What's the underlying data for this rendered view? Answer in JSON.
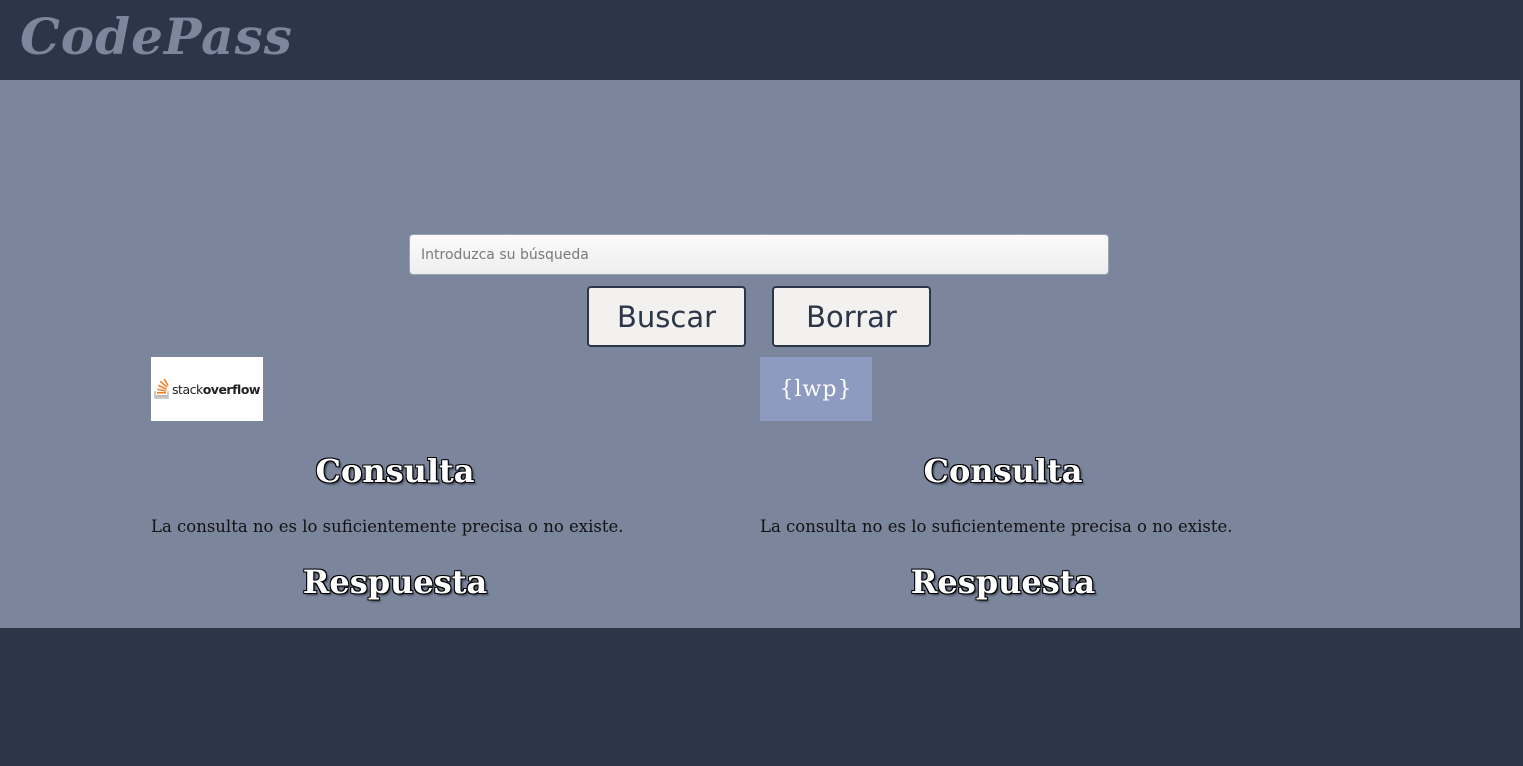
{
  "header": {
    "brand": "CodePass"
  },
  "search": {
    "placeholder": "Introduzca su búsqueda",
    "value": "",
    "search_button": "Buscar",
    "clear_button": "Borrar"
  },
  "results": [
    {
      "source": "stackoverflow",
      "logo_text_regular": "stack",
      "logo_text_bold": "overflow",
      "query_heading": "Consulta",
      "message": "La consulta no es lo suficientemente precisa o no existe.",
      "answer_heading": "Respuesta"
    },
    {
      "source": "lwp",
      "logo_text": "{lwp}",
      "query_heading": "Consulta",
      "message": "La consulta no es lo suficientemente precisa o no existe.",
      "answer_heading": "Respuesta"
    }
  ],
  "colors": {
    "header_bg": "#2d3649",
    "main_bg": "#7b869d",
    "brand_text": "#7c879e",
    "lwp_logo_bg": "#8e9bc0"
  },
  "icons": {
    "stackoverflow_logo": "stackoverflow-logo-icon",
    "lwp_logo": "lwp-logo-icon"
  }
}
